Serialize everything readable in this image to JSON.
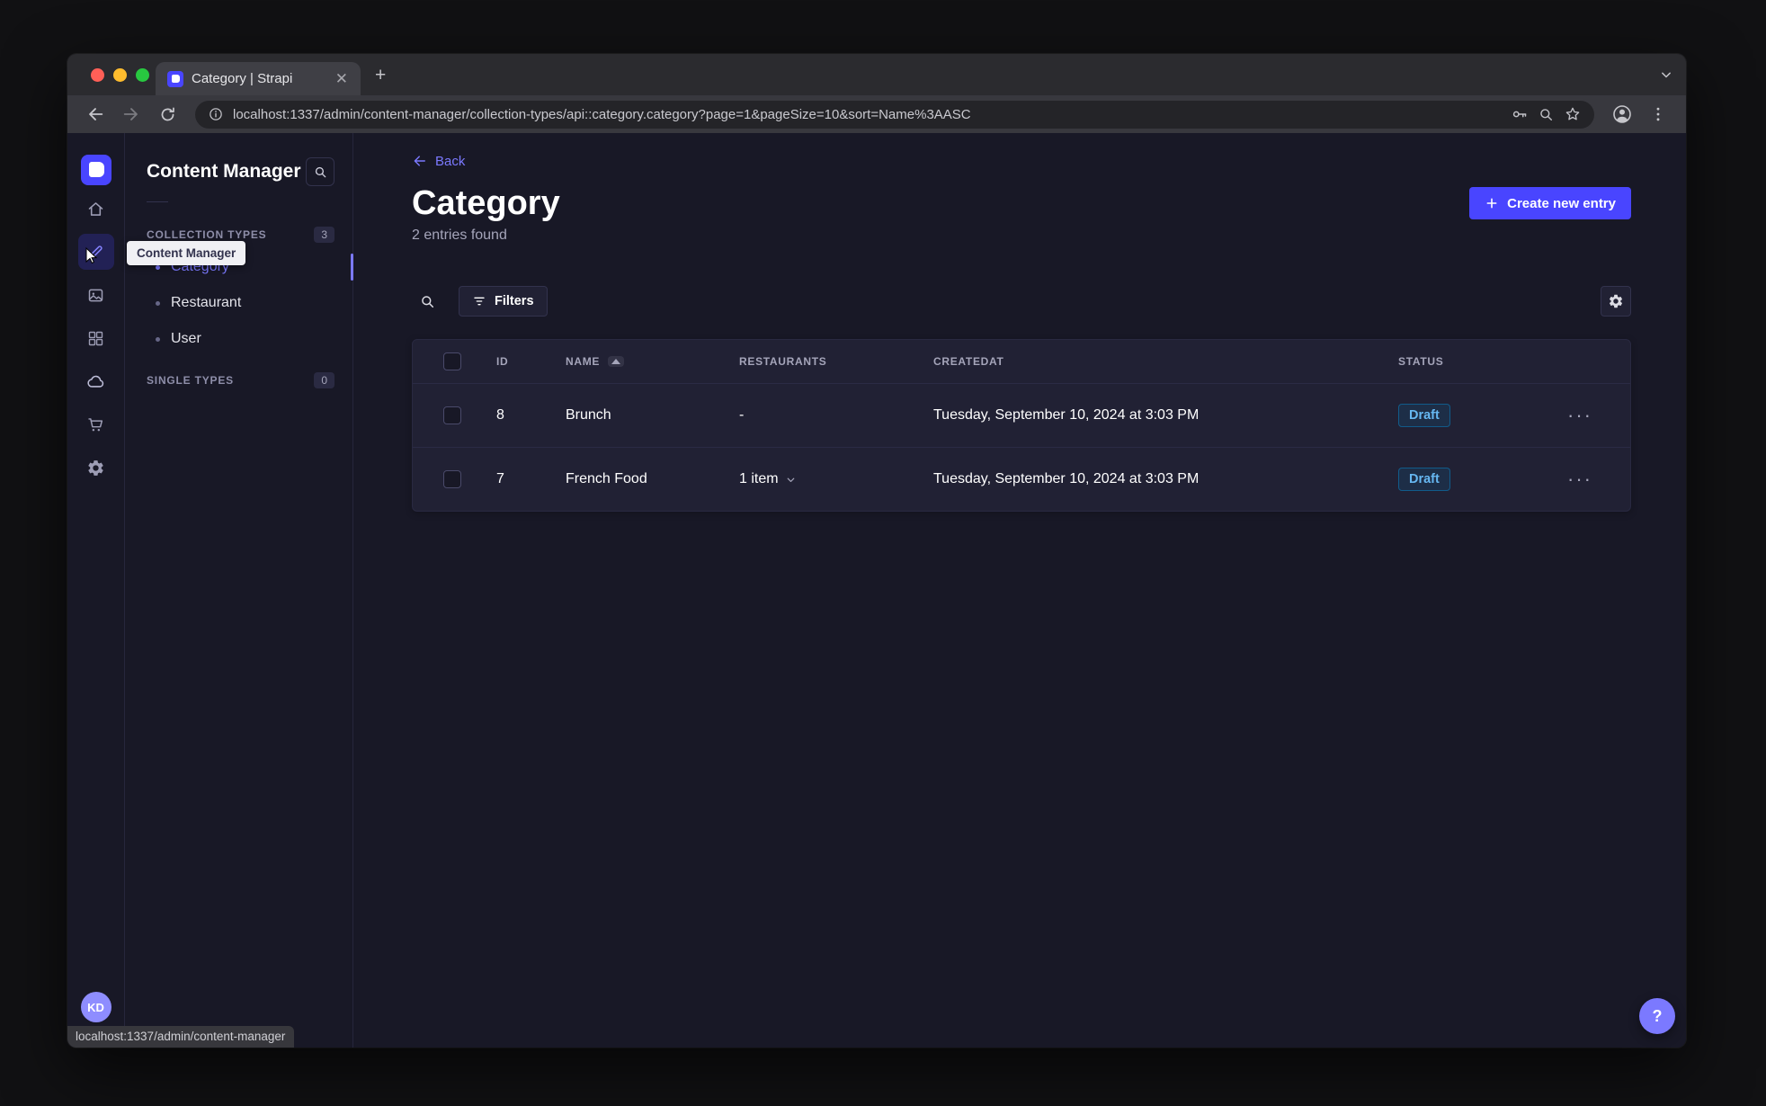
{
  "browser": {
    "tab_title": "Category | Strapi",
    "url": "localhost:1337/admin/content-manager/collection-types/api::category.category?page=1&pageSize=10&sort=Name%3AASC",
    "status_link": "localhost:1337/admin/content-manager"
  },
  "rail": {
    "avatar_initials": "KD",
    "icons": [
      "home",
      "content-manager",
      "media-library",
      "content-type-builder",
      "cloud",
      "marketplace",
      "settings"
    ]
  },
  "tooltip": {
    "text": "Content Manager"
  },
  "sidebar": {
    "title": "Content Manager",
    "collection_types_label": "COLLECTION TYPES",
    "collection_types_badge": "3",
    "single_types_label": "SINGLE TYPES",
    "single_types_badge": "0",
    "items": [
      {
        "label": "Category"
      },
      {
        "label": "Restaurant"
      },
      {
        "label": "User"
      }
    ]
  },
  "header": {
    "back_label": "Back",
    "title": "Category",
    "subtitle": "2 entries found",
    "create_button_label": "Create new entry"
  },
  "toolbar": {
    "filters_label": "Filters"
  },
  "table": {
    "headers": {
      "id": "ID",
      "name": "NAME",
      "restaurants": "RESTAURANTS",
      "createdat": "CREATEDAT",
      "status": "STATUS"
    },
    "rows": [
      {
        "id": "8",
        "name": "Brunch",
        "restaurants": "-",
        "createdat": "Tuesday, September 10, 2024 at 3:03 PM",
        "status": "Draft"
      },
      {
        "id": "7",
        "name": "French Food",
        "restaurants": "1 item",
        "createdat": "Tuesday, September 10, 2024 at 3:03 PM",
        "status": "Draft"
      }
    ]
  },
  "help": {
    "label": "?"
  },
  "colors": {
    "primary": "#4945ff",
    "primary_light": "#7b79ff",
    "app_bg": "#181826",
    "surface": "#212134",
    "border": "#32324d",
    "text_muted": "#a5a5ba",
    "draft_text": "#66b7f1"
  }
}
